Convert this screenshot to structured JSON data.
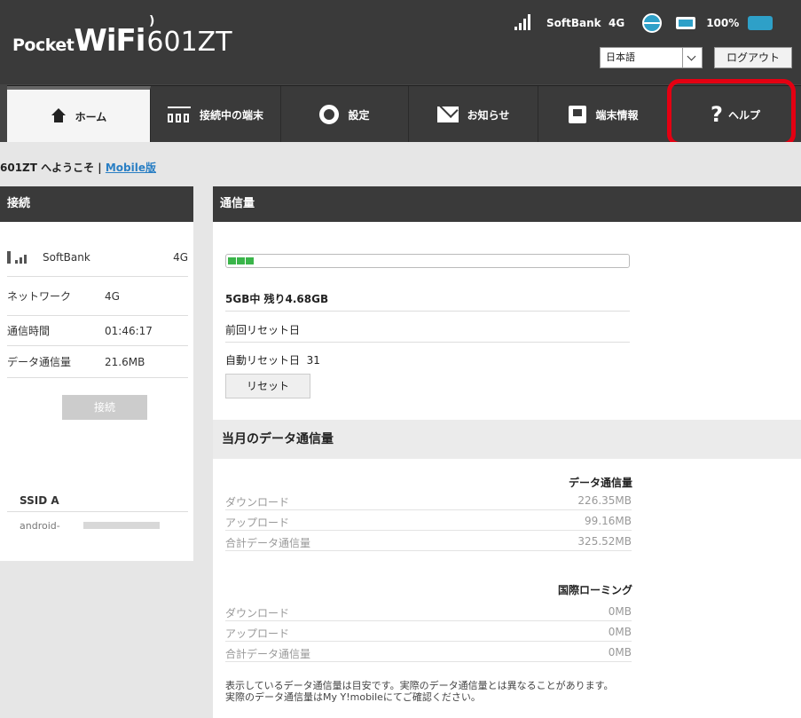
{
  "header": {
    "logo_pocket": "Pocket",
    "logo_wifi": "WiFi",
    "logo_model": "601ZT",
    "carrier": "SoftBank",
    "network": "4G",
    "battery": "100%",
    "language": "日本語",
    "logout_label": "ログアウト"
  },
  "nav": [
    {
      "label": "ホーム"
    },
    {
      "label": "接続中の端末"
    },
    {
      "label": "設定"
    },
    {
      "label": "お知らせ"
    },
    {
      "label": "端末情報"
    },
    {
      "label": "ヘルプ"
    }
  ],
  "welcome": {
    "text": "601ZT へようこそ | ",
    "mobile_link": "Mobile版"
  },
  "connection": {
    "title": "接続",
    "carrier": "SoftBank",
    "carrier_network": "4G",
    "network_label": "ネットワーク",
    "network_value": "4G",
    "time_label": "通信時間",
    "time_value": "01:46:17",
    "data_label": "データ通信量",
    "data_value": "21.6MB",
    "connect_button": "接続",
    "ssid_label": "SSID A",
    "ssid_value": "android-"
  },
  "usage": {
    "title": "通信量",
    "progress_fraction": 0.064,
    "summary": "5GB中 残り4.68GB",
    "last_reset_label": "前回リセット日",
    "auto_reset_label": "自動リセット日",
    "auto_reset_value": "31",
    "reset_button": "リセット"
  },
  "monthly": {
    "title": "当月のデータ通信量",
    "data_heading": "データ通信量",
    "download_label": "ダウンロード",
    "download_value": "226.35MB",
    "upload_label": "アップロード",
    "upload_value": "99.16MB",
    "total_label": "合計データ通信量",
    "total_value": "325.52MB",
    "roaming_heading": "国際ローミング",
    "roaming_download_label": "ダウンロード",
    "roaming_download_value": "0MB",
    "roaming_upload_label": "アップロード",
    "roaming_upload_value": "0MB",
    "roaming_total_label": "合計データ通信量",
    "roaming_total_value": "0MB",
    "note_line1": "表示しているデータ通信量は目安です。実際のデータ通信量とは異なることがあります。",
    "note_line2": "実際のデータ通信量はMy Y!mobileにてご確認ください。"
  },
  "colors": {
    "header_bg": "#3a3a3a",
    "accent": "#2ea0c8",
    "usage_bar": "#3ab54a",
    "highlight": "#e40012"
  }
}
